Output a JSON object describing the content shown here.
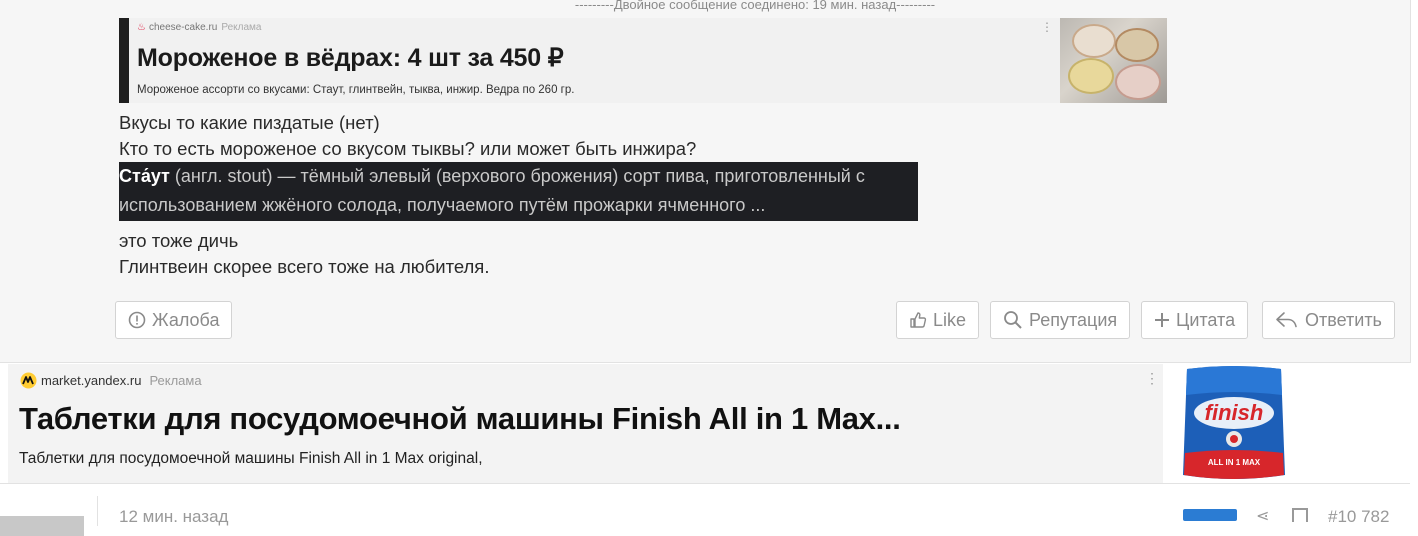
{
  "post": {
    "merged_note": "---------Двойное сообщение соединено: 19 мин. назад---------",
    "embedded_ad": {
      "source": "cheese-cake.ru",
      "tag": "Реклама",
      "headline": "Мороженое в вёдрах: 4 шт за 450 ₽",
      "description": "Мороженое ассорти со вкусами: Стаут, глинтвейн, тыква, инжир. Ведра по 260 гр."
    },
    "lines": [
      "Вкусы то какие пиздатые (нет)",
      "Кто то есть мороженое со вкусом тыквы? или может быть инжира?"
    ],
    "quote": {
      "term": "Ста́ут",
      "line1_rest": " (англ. stout) — тёмный элевый (верхового брожения) сорт пива, приготовленный с",
      "line2": "использованием жжёного солода, получаемого путём прожарки ячменного ..."
    },
    "lines_after": [
      "это тоже дичь",
      "Глинтвеин скорее всего тоже на любителя."
    ],
    "buttons": {
      "report": "Жалоба",
      "like": "Like",
      "reputation": "Репутация",
      "quote": "Цитата",
      "reply": "Ответить"
    }
  },
  "ad": {
    "source": "market.yandex.ru",
    "tag": "Реклама",
    "title": "Таблетки для посудомоечной машины Finish All in 1 Max...",
    "description": "Таблетки для посудомоечной машины Finish All in 1 Max original,",
    "product_brand": "finish",
    "product_variant": "ALL IN 1 MAX"
  },
  "next_post": {
    "time": "12 мин. назад",
    "number": "#10 782"
  },
  "colors": {
    "post_bg": "#f6f6f6",
    "quote_bg": "#1e1f23",
    "finish_blue": "#1d5fb8",
    "finish_red": "#d7262b",
    "badge_blue": "#2b7cd3"
  }
}
